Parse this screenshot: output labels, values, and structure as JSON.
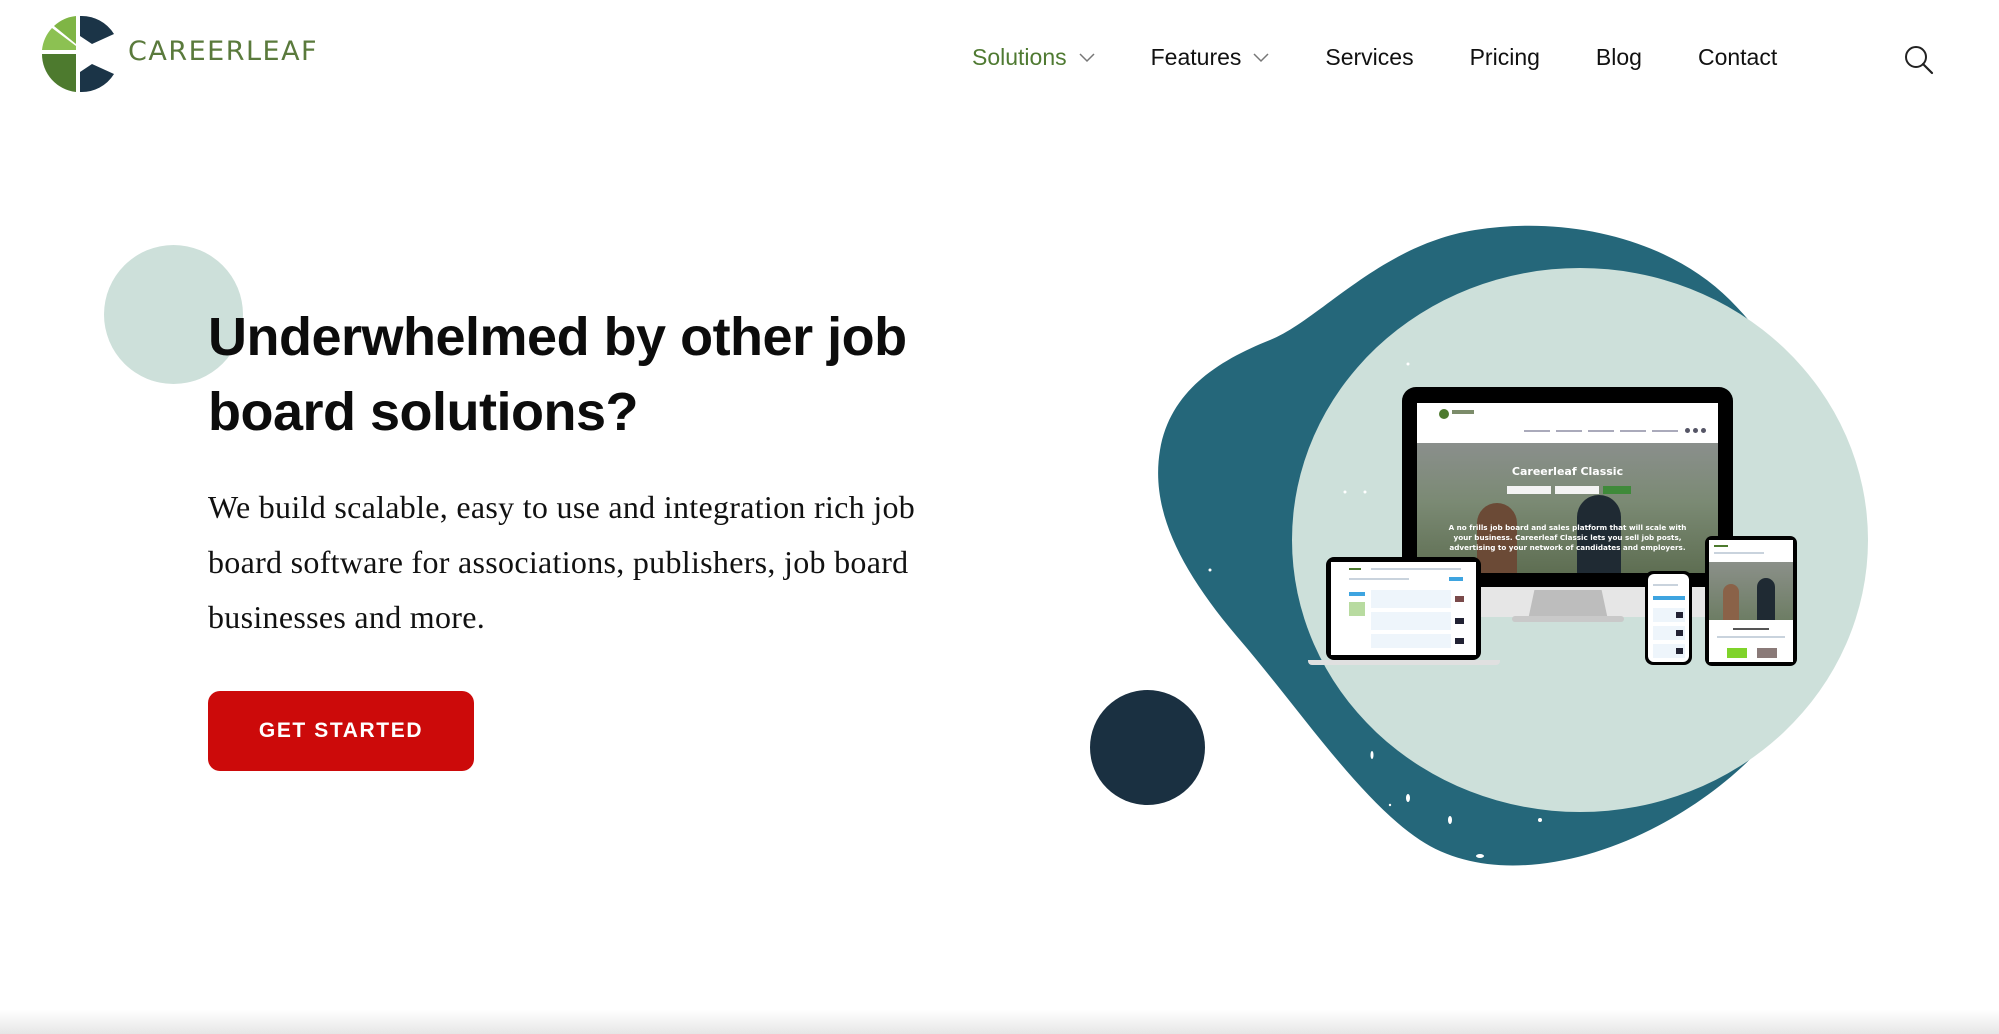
{
  "brand": {
    "name": "CAREERLEAF",
    "colors": {
      "green": "#5a7a3c",
      "dark_navy": "#1a3041",
      "teal": "#25677a",
      "mint": "#cde0da",
      "cta_red": "#cc0a0a"
    }
  },
  "nav": {
    "items": [
      {
        "label": "Solutions",
        "has_dropdown": true,
        "active": true
      },
      {
        "label": "Features",
        "has_dropdown": true,
        "active": false
      },
      {
        "label": "Services",
        "has_dropdown": false,
        "active": false
      },
      {
        "label": "Pricing",
        "has_dropdown": false,
        "active": false
      },
      {
        "label": "Blog",
        "has_dropdown": false,
        "active": false
      },
      {
        "label": "Contact",
        "has_dropdown": false,
        "active": false
      }
    ],
    "search_icon": "search-icon"
  },
  "hero": {
    "title": "Underwhelmed by other job board solutions?",
    "description": "We build scalable, easy to use and integration rich job board software for associations, publishers, job board businesses and more.",
    "cta_label": "GET STARTED"
  },
  "mockup": {
    "screen_title": "Careerleaf Classic",
    "screen_description": "A no frills job board and sales platform that will scale with your business. Careerleaf Classic lets you sell job posts, advertising to your network of candidates and employers."
  }
}
